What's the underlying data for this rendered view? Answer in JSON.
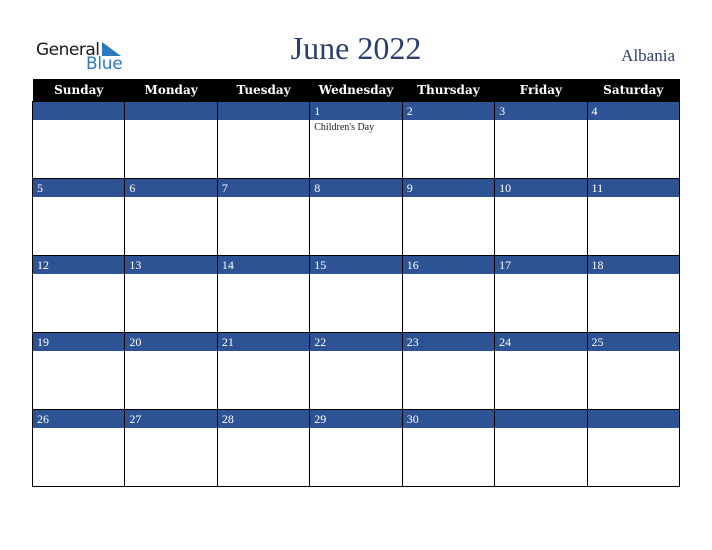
{
  "logo": {
    "general": "General",
    "blue": "Blue"
  },
  "title": "June 2022",
  "country": "Albania",
  "colors": {
    "header_bg": "#000000",
    "date_bar": "#2e5394",
    "title": "#2a3f6b",
    "logo_blue": "#2a7abf"
  },
  "weekdays": [
    "Sunday",
    "Monday",
    "Tuesday",
    "Wednesday",
    "Thursday",
    "Friday",
    "Saturday"
  ],
  "weeks": [
    [
      {
        "day": "",
        "event": ""
      },
      {
        "day": "",
        "event": ""
      },
      {
        "day": "",
        "event": ""
      },
      {
        "day": "1",
        "event": "Children's Day"
      },
      {
        "day": "2",
        "event": ""
      },
      {
        "day": "3",
        "event": ""
      },
      {
        "day": "4",
        "event": ""
      }
    ],
    [
      {
        "day": "5",
        "event": ""
      },
      {
        "day": "6",
        "event": ""
      },
      {
        "day": "7",
        "event": ""
      },
      {
        "day": "8",
        "event": ""
      },
      {
        "day": "9",
        "event": ""
      },
      {
        "day": "10",
        "event": ""
      },
      {
        "day": "11",
        "event": ""
      }
    ],
    [
      {
        "day": "12",
        "event": ""
      },
      {
        "day": "13",
        "event": ""
      },
      {
        "day": "14",
        "event": ""
      },
      {
        "day": "15",
        "event": ""
      },
      {
        "day": "16",
        "event": ""
      },
      {
        "day": "17",
        "event": ""
      },
      {
        "day": "18",
        "event": ""
      }
    ],
    [
      {
        "day": "19",
        "event": ""
      },
      {
        "day": "20",
        "event": ""
      },
      {
        "day": "21",
        "event": ""
      },
      {
        "day": "22",
        "event": ""
      },
      {
        "day": "23",
        "event": ""
      },
      {
        "day": "24",
        "event": ""
      },
      {
        "day": "25",
        "event": ""
      }
    ],
    [
      {
        "day": "26",
        "event": ""
      },
      {
        "day": "27",
        "event": ""
      },
      {
        "day": "28",
        "event": ""
      },
      {
        "day": "29",
        "event": ""
      },
      {
        "day": "30",
        "event": ""
      },
      {
        "day": "",
        "event": ""
      },
      {
        "day": "",
        "event": ""
      }
    ]
  ]
}
